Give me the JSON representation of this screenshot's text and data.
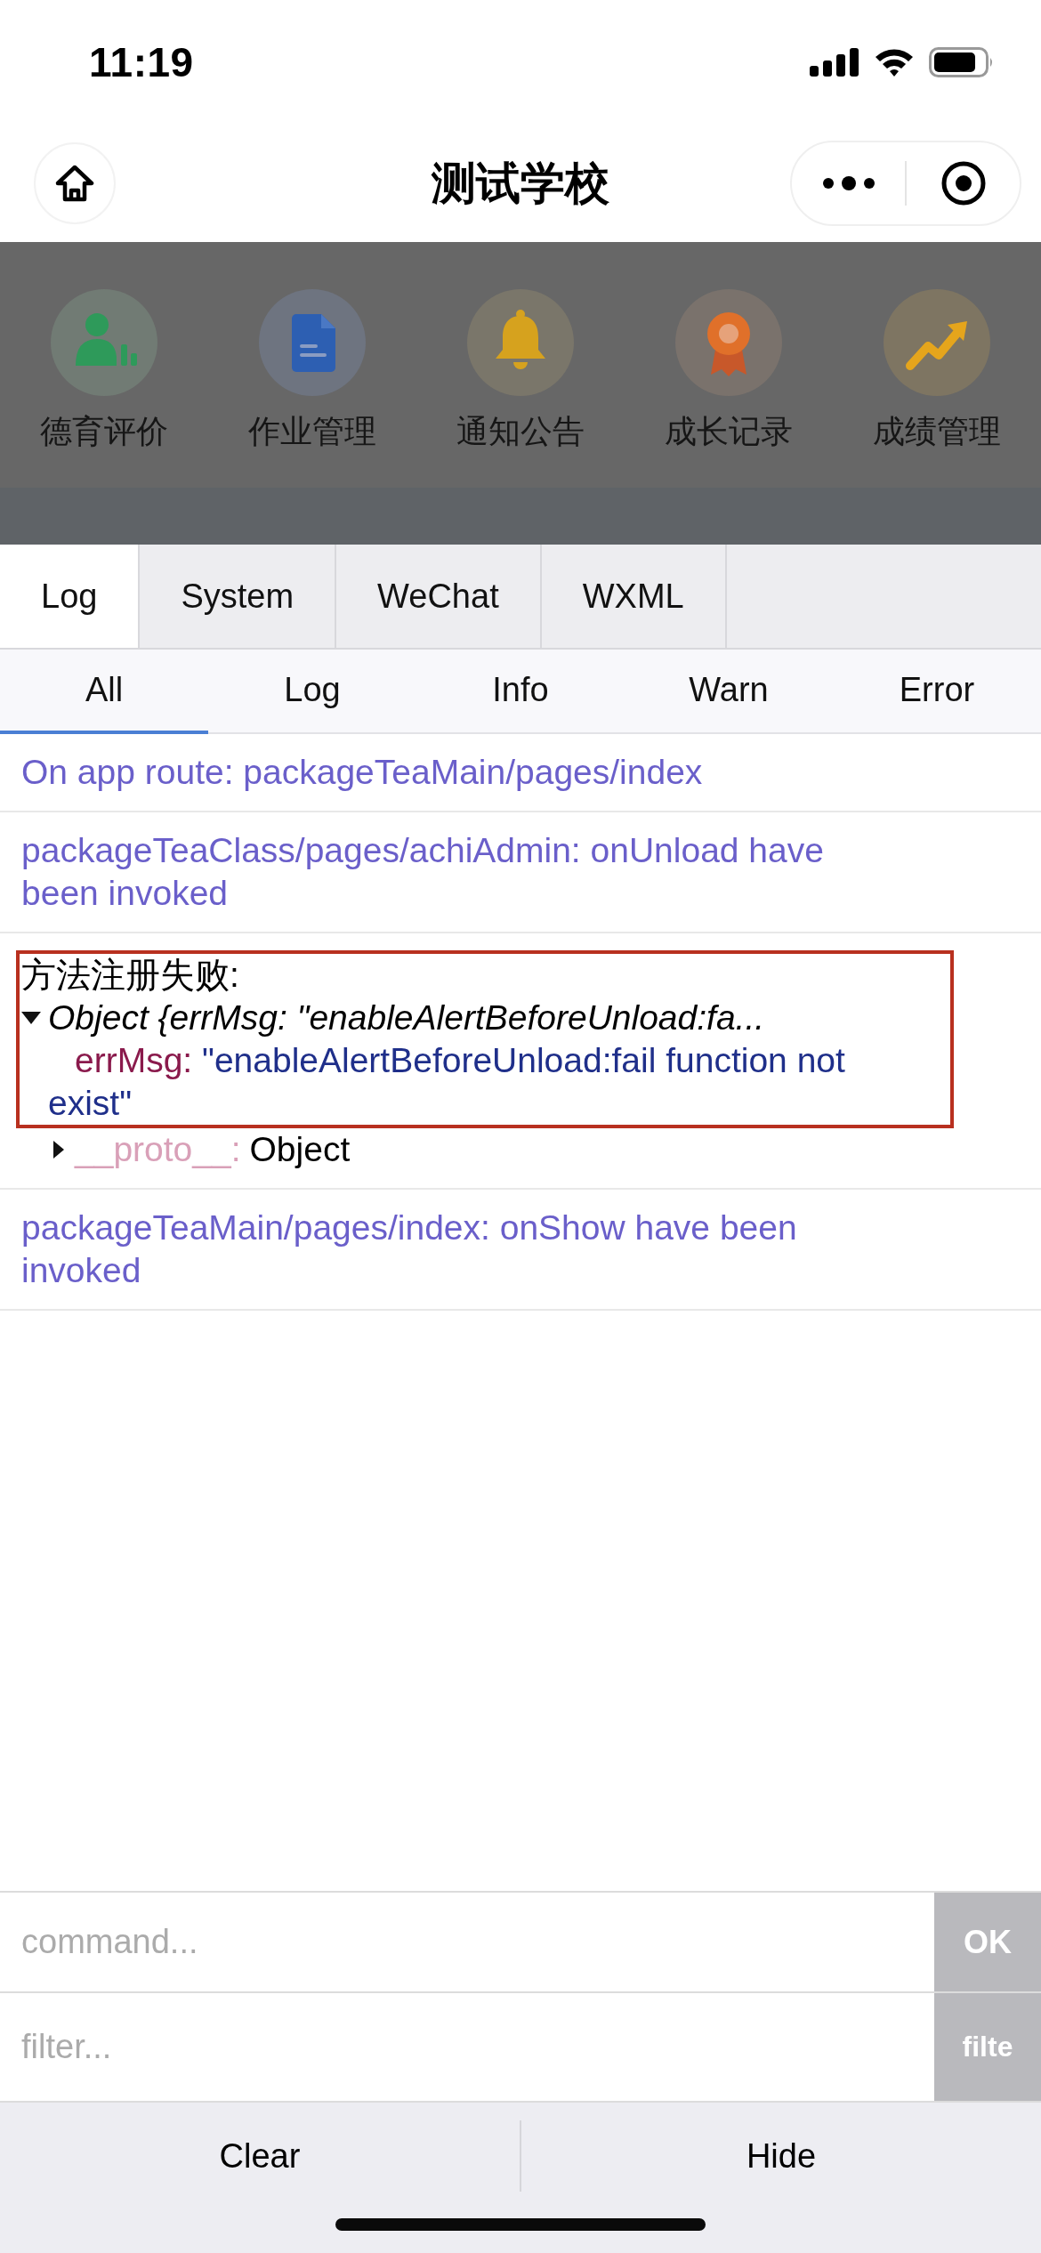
{
  "status_bar": {
    "time": "11:19"
  },
  "nav_bar": {
    "title": "测试学校"
  },
  "menu": [
    {
      "kind": "person",
      "label": "德育评价"
    },
    {
      "kind": "document",
      "label": "作业管理"
    },
    {
      "kind": "bell",
      "label": "通知公告"
    },
    {
      "kind": "award",
      "label": "成长记录"
    },
    {
      "kind": "chart",
      "label": "成绩管理"
    }
  ],
  "tabs": [
    {
      "label": "Log",
      "selected": true
    },
    {
      "label": "System",
      "selected": false
    },
    {
      "label": "WeChat",
      "selected": false
    },
    {
      "label": "WXML",
      "selected": false
    }
  ],
  "filter_tabs": [
    {
      "label": "All",
      "selected": true
    },
    {
      "label": "Log",
      "selected": false
    },
    {
      "label": "Info",
      "selected": false
    },
    {
      "label": "Warn",
      "selected": false
    },
    {
      "label": "Error",
      "selected": false
    }
  ],
  "log_entries": [
    {
      "kind": "message",
      "text": "On app route: packageTeaMain/pages/index"
    },
    {
      "kind": "message",
      "text": "packageTeaClass/pages/achiAdmin: onUnload have been invoked"
    },
    {
      "kind": "object",
      "label": "方法注册失败:",
      "summary": "Object {errMsg: \"enableAlertBeforeUnload:fa...",
      "expanded": true,
      "highlighted": true,
      "properties": [
        {
          "key": "errMsg:",
          "value": "\"enableAlertBeforeUnload:fail function not exist\""
        }
      ],
      "proto": {
        "key": "__proto__:",
        "value": "Object",
        "expanded": false
      }
    },
    {
      "kind": "message",
      "text": "packageTeaMain/pages/index: onShow have been invoked"
    }
  ],
  "command": {
    "placeholder": "command...",
    "button": "OK"
  },
  "filter": {
    "placeholder": "filter...",
    "button": "filte"
  },
  "actions": [
    "Clear",
    "Hide"
  ]
}
